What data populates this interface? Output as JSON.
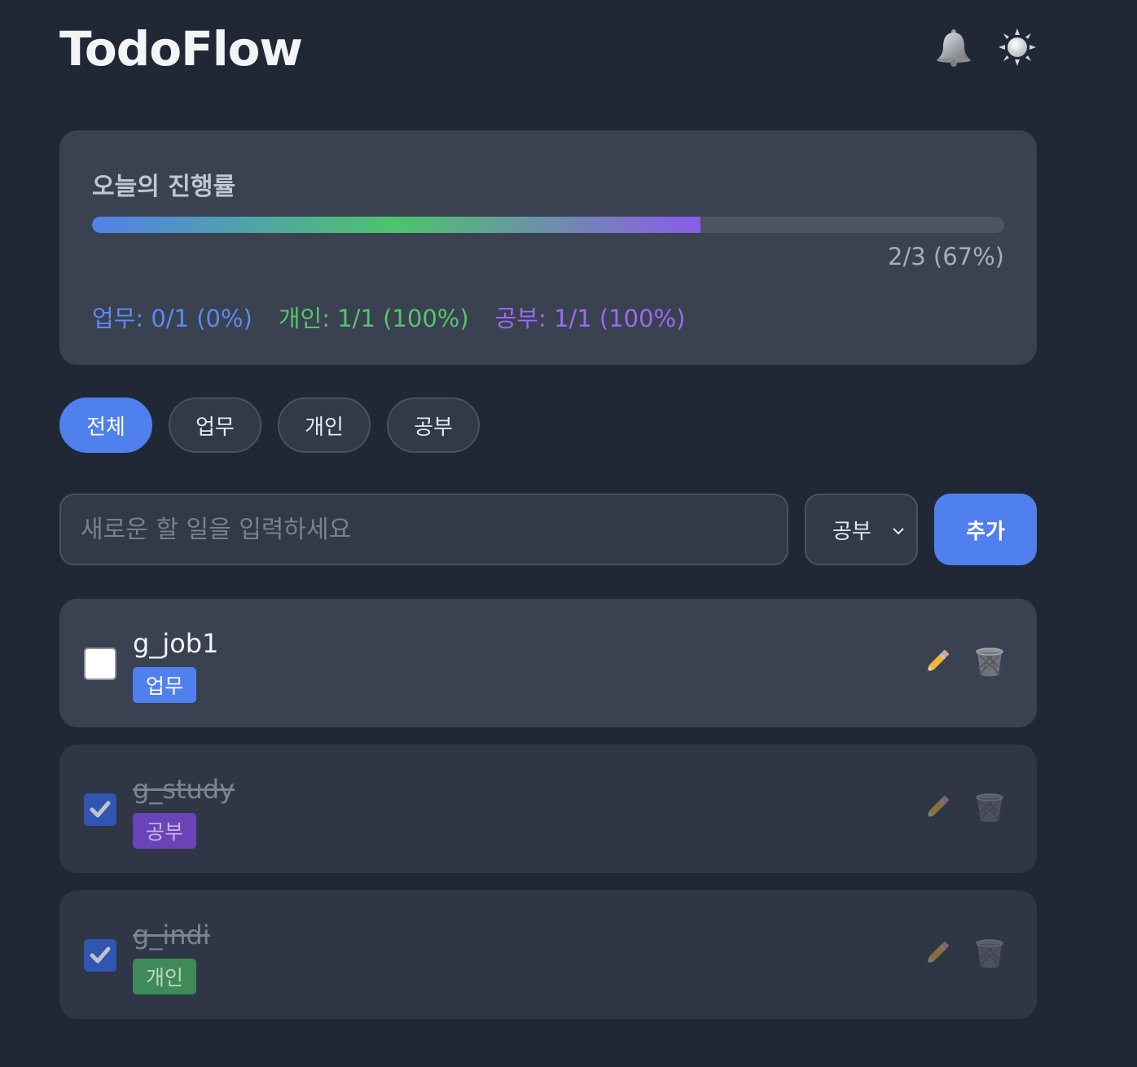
{
  "header": {
    "title": "TodoFlow",
    "bell_icon": "bell-icon",
    "theme_icon": "sun-icon"
  },
  "progress": {
    "title": "오늘의 진행률",
    "done": 2,
    "total": 3,
    "percent": 67,
    "label": "2/3 (67%)",
    "stats": {
      "work": "업무: 0/1 (0%)",
      "personal": "개인: 1/1 (100%)",
      "study": "공부: 1/1 (100%)"
    }
  },
  "filters": [
    {
      "label": "전체",
      "active": true
    },
    {
      "label": "업무",
      "active": false
    },
    {
      "label": "개인",
      "active": false
    },
    {
      "label": "공부",
      "active": false
    }
  ],
  "add_form": {
    "placeholder": "새로운 할 일을 입력하세요",
    "value": "",
    "category_selected": "공부",
    "add_label": "추가"
  },
  "tasks": [
    {
      "text": "g_job1",
      "category": "업무",
      "done": false
    },
    {
      "text": "g_study",
      "category": "공부",
      "done": true
    },
    {
      "text": "g_indi",
      "category": "개인",
      "done": true
    }
  ],
  "colors": {
    "background": "#202836",
    "card": "#3a4150",
    "accent": "#4f80ee",
    "work": "#5b8bf0",
    "personal": "#57c46d",
    "study": "#9a6bf0"
  }
}
